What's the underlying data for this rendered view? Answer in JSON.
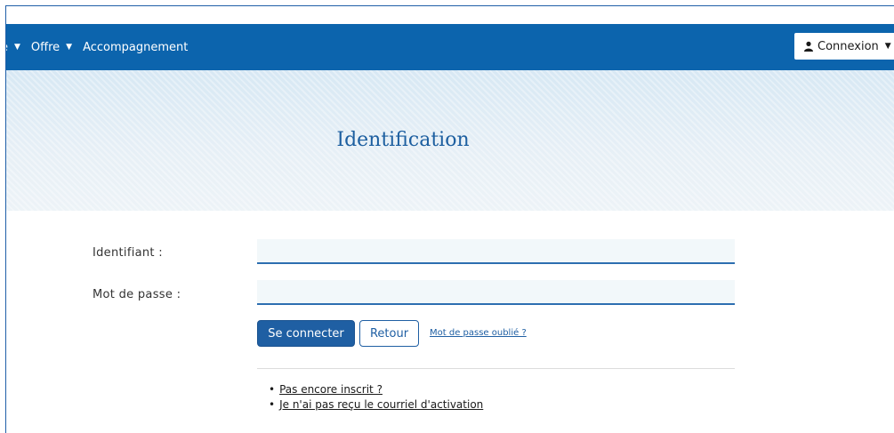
{
  "nav": {
    "items": [
      {
        "label": "e",
        "has_caret": true
      },
      {
        "label": "Offre",
        "has_caret": true
      },
      {
        "label": "Accompagnement",
        "has_caret": false
      }
    ],
    "login_label": "Connexion",
    "login_icon": "user-icon"
  },
  "banner": {
    "title": "Identification"
  },
  "form": {
    "username_label": "Identifiant :",
    "username_value": "",
    "password_label": "Mot de passe :",
    "password_value": "",
    "submit_label": "Se connecter",
    "back_label": "Retour",
    "forgot_label": "Mot de passe oublié ?"
  },
  "links": {
    "not_registered": "Pas encore inscrit ?",
    "no_activation": "Je n'ai pas reçu le courriel d'activation"
  },
  "colors": {
    "navbar": "#0c64ad",
    "primary": "#1f5fa3",
    "banner_title": "#1d5fa0"
  }
}
